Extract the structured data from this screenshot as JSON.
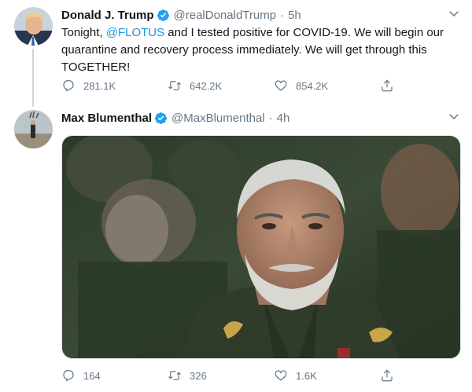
{
  "tweets": [
    {
      "name": "Donald J. Trump",
      "handle": "@realDonaldTrump",
      "separator": "·",
      "time": "5h",
      "text_before": "Tonight, ",
      "mention": "@FLOTUS",
      "text_after": " and I tested positive for COVID-19. We will begin our quarantine and recovery process immediately. We will get through this TOGETHER!",
      "replies": "281.1K",
      "retweets": "642.2K",
      "likes": "854.2K"
    },
    {
      "name": "Max Blumenthal",
      "handle": "@MaxBlumenthal",
      "separator": "·",
      "time": "4h",
      "replies": "164",
      "retweets": "326",
      "likes": "1.6K"
    }
  ],
  "icons": {
    "verified": "verified-badge-icon",
    "reply": "reply-icon",
    "retweet": "retweet-icon",
    "like": "heart-icon",
    "share": "share-icon",
    "more": "chevron-down-icon"
  },
  "colors": {
    "accent": "#1da1f2",
    "mention": "#1b95e0",
    "secondary_text": "#657786",
    "thread_line": "#ccd6dd"
  }
}
